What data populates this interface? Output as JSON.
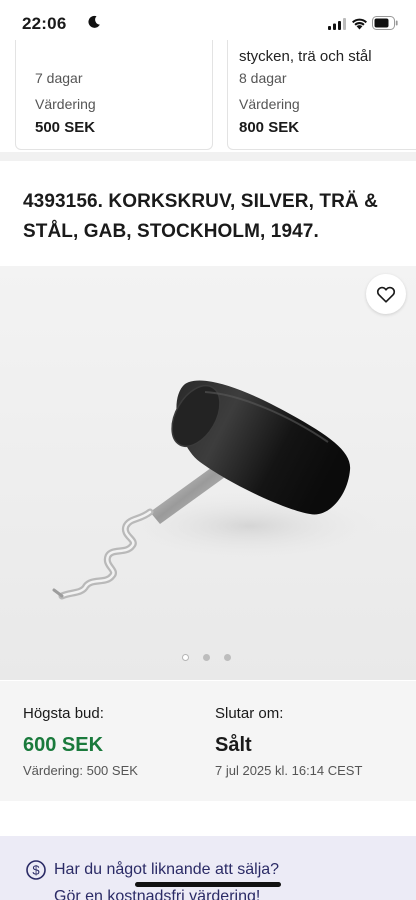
{
  "status_bar": {
    "time": "22:06"
  },
  "related_cards": [
    {
      "title": "",
      "days": "7 dagar",
      "valuation_label": "Värdering",
      "valuation_value": "500 SEK"
    },
    {
      "title": "stycken, trä och stål",
      "days": "8 dagar",
      "valuation_label": "Värdering",
      "valuation_value": "800 SEK"
    }
  ],
  "lot": {
    "title": "4393156. KORKSKRUV, SILVER, TRÄ & STÅL, GAB, STOCKHOLM, 1947.",
    "image_count": 3,
    "active_image": 1
  },
  "bidding": {
    "highest_bid_label": "Högsta bud:",
    "highest_bid_value": "600 SEK",
    "valuation_text": "Värdering: 500 SEK",
    "ends_label": "Slutar om:",
    "ends_value": "Sålt",
    "end_date": "7 jul 2025 kl. 16:14 CEST"
  },
  "sell_banner": {
    "line1": "Har du något liknande att sälja?",
    "line2": "Gör en kostnadsfri värdering!"
  },
  "colors": {
    "bid_green": "#1a7a3c",
    "banner_bg": "#ecebf6",
    "banner_text": "#2b2b66"
  }
}
